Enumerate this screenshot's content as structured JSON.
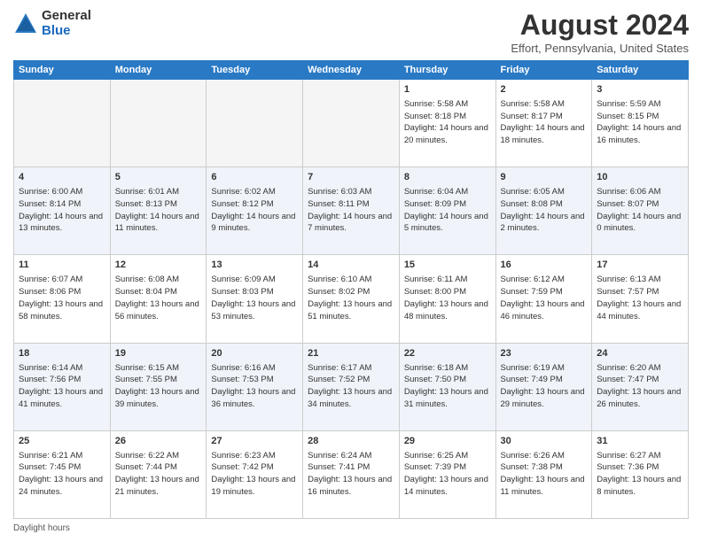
{
  "header": {
    "logo_general": "General",
    "logo_blue": "Blue",
    "month_year": "August 2024",
    "location": "Effort, Pennsylvania, United States"
  },
  "weekdays": [
    "Sunday",
    "Monday",
    "Tuesday",
    "Wednesday",
    "Thursday",
    "Friday",
    "Saturday"
  ],
  "weeks": [
    [
      {
        "day": "",
        "info": ""
      },
      {
        "day": "",
        "info": ""
      },
      {
        "day": "",
        "info": ""
      },
      {
        "day": "",
        "info": ""
      },
      {
        "day": "1",
        "info": "Sunrise: 5:58 AM\nSunset: 8:18 PM\nDaylight: 14 hours and 20 minutes."
      },
      {
        "day": "2",
        "info": "Sunrise: 5:58 AM\nSunset: 8:17 PM\nDaylight: 14 hours and 18 minutes."
      },
      {
        "day": "3",
        "info": "Sunrise: 5:59 AM\nSunset: 8:15 PM\nDaylight: 14 hours and 16 minutes."
      }
    ],
    [
      {
        "day": "4",
        "info": "Sunrise: 6:00 AM\nSunset: 8:14 PM\nDaylight: 14 hours and 13 minutes."
      },
      {
        "day": "5",
        "info": "Sunrise: 6:01 AM\nSunset: 8:13 PM\nDaylight: 14 hours and 11 minutes."
      },
      {
        "day": "6",
        "info": "Sunrise: 6:02 AM\nSunset: 8:12 PM\nDaylight: 14 hours and 9 minutes."
      },
      {
        "day": "7",
        "info": "Sunrise: 6:03 AM\nSunset: 8:11 PM\nDaylight: 14 hours and 7 minutes."
      },
      {
        "day": "8",
        "info": "Sunrise: 6:04 AM\nSunset: 8:09 PM\nDaylight: 14 hours and 5 minutes."
      },
      {
        "day": "9",
        "info": "Sunrise: 6:05 AM\nSunset: 8:08 PM\nDaylight: 14 hours and 2 minutes."
      },
      {
        "day": "10",
        "info": "Sunrise: 6:06 AM\nSunset: 8:07 PM\nDaylight: 14 hours and 0 minutes."
      }
    ],
    [
      {
        "day": "11",
        "info": "Sunrise: 6:07 AM\nSunset: 8:06 PM\nDaylight: 13 hours and 58 minutes."
      },
      {
        "day": "12",
        "info": "Sunrise: 6:08 AM\nSunset: 8:04 PM\nDaylight: 13 hours and 56 minutes."
      },
      {
        "day": "13",
        "info": "Sunrise: 6:09 AM\nSunset: 8:03 PM\nDaylight: 13 hours and 53 minutes."
      },
      {
        "day": "14",
        "info": "Sunrise: 6:10 AM\nSunset: 8:02 PM\nDaylight: 13 hours and 51 minutes."
      },
      {
        "day": "15",
        "info": "Sunrise: 6:11 AM\nSunset: 8:00 PM\nDaylight: 13 hours and 48 minutes."
      },
      {
        "day": "16",
        "info": "Sunrise: 6:12 AM\nSunset: 7:59 PM\nDaylight: 13 hours and 46 minutes."
      },
      {
        "day": "17",
        "info": "Sunrise: 6:13 AM\nSunset: 7:57 PM\nDaylight: 13 hours and 44 minutes."
      }
    ],
    [
      {
        "day": "18",
        "info": "Sunrise: 6:14 AM\nSunset: 7:56 PM\nDaylight: 13 hours and 41 minutes."
      },
      {
        "day": "19",
        "info": "Sunrise: 6:15 AM\nSunset: 7:55 PM\nDaylight: 13 hours and 39 minutes."
      },
      {
        "day": "20",
        "info": "Sunrise: 6:16 AM\nSunset: 7:53 PM\nDaylight: 13 hours and 36 minutes."
      },
      {
        "day": "21",
        "info": "Sunrise: 6:17 AM\nSunset: 7:52 PM\nDaylight: 13 hours and 34 minutes."
      },
      {
        "day": "22",
        "info": "Sunrise: 6:18 AM\nSunset: 7:50 PM\nDaylight: 13 hours and 31 minutes."
      },
      {
        "day": "23",
        "info": "Sunrise: 6:19 AM\nSunset: 7:49 PM\nDaylight: 13 hours and 29 minutes."
      },
      {
        "day": "24",
        "info": "Sunrise: 6:20 AM\nSunset: 7:47 PM\nDaylight: 13 hours and 26 minutes."
      }
    ],
    [
      {
        "day": "25",
        "info": "Sunrise: 6:21 AM\nSunset: 7:45 PM\nDaylight: 13 hours and 24 minutes."
      },
      {
        "day": "26",
        "info": "Sunrise: 6:22 AM\nSunset: 7:44 PM\nDaylight: 13 hours and 21 minutes."
      },
      {
        "day": "27",
        "info": "Sunrise: 6:23 AM\nSunset: 7:42 PM\nDaylight: 13 hours and 19 minutes."
      },
      {
        "day": "28",
        "info": "Sunrise: 6:24 AM\nSunset: 7:41 PM\nDaylight: 13 hours and 16 minutes."
      },
      {
        "day": "29",
        "info": "Sunrise: 6:25 AM\nSunset: 7:39 PM\nDaylight: 13 hours and 14 minutes."
      },
      {
        "day": "30",
        "info": "Sunrise: 6:26 AM\nSunset: 7:38 PM\nDaylight: 13 hours and 11 minutes."
      },
      {
        "day": "31",
        "info": "Sunrise: 6:27 AM\nSunset: 7:36 PM\nDaylight: 13 hours and 8 minutes."
      }
    ]
  ],
  "footer": {
    "daylight_label": "Daylight hours"
  }
}
